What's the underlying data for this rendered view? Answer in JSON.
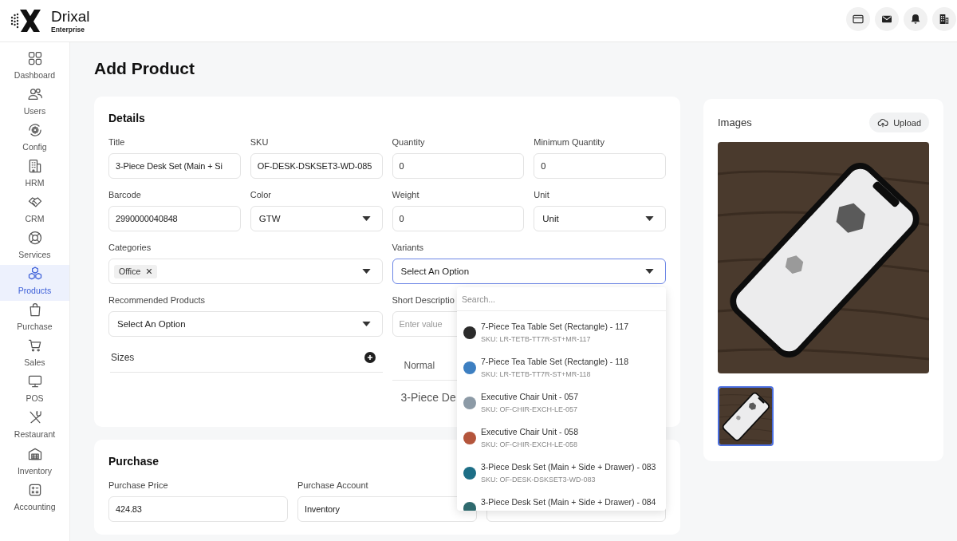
{
  "header": {
    "brand": "Drixal",
    "edition": "Enterprise"
  },
  "sidebar": {
    "items": [
      {
        "label": "Dashboard",
        "selected": false
      },
      {
        "label": "Users",
        "selected": false
      },
      {
        "label": "Config",
        "selected": false
      },
      {
        "label": "HRM",
        "selected": false
      },
      {
        "label": "CRM",
        "selected": false
      },
      {
        "label": "Services",
        "selected": false
      },
      {
        "label": "Products",
        "selected": true
      },
      {
        "label": "Purchase",
        "selected": false
      },
      {
        "label": "Sales",
        "selected": false
      },
      {
        "label": "POS",
        "selected": false
      },
      {
        "label": "Restaurant",
        "selected": false
      },
      {
        "label": "Inventory",
        "selected": false
      },
      {
        "label": "Accounting",
        "selected": false
      }
    ]
  },
  "page": {
    "title": "Add Product"
  },
  "details": {
    "title": "Details",
    "fields": [
      {
        "label": "Title",
        "kind": "input",
        "value": "3-Piece Desk Set (Main + Si"
      },
      {
        "label": "SKU",
        "kind": "input",
        "value": "OF-DESK-DSKSET3-WD-085"
      },
      {
        "label": "Quantity",
        "kind": "input",
        "value": "0"
      },
      {
        "label": "Minimum Quantity",
        "kind": "input",
        "value": "0"
      },
      {
        "label": "Barcode",
        "kind": "input",
        "value": "2990000040848"
      },
      {
        "label": "Color",
        "kind": "select",
        "value": "GTW"
      },
      {
        "label": "Weight",
        "kind": "input",
        "value": "0"
      },
      {
        "label": "Unit",
        "kind": "select",
        "value": "Unit"
      }
    ],
    "categories": {
      "label": "Categories",
      "tags": [
        {
          "label": "Office"
        }
      ]
    },
    "variants": {
      "label": "Variants",
      "placeholder": "Select An Option",
      "expanded": true,
      "dropdown": {
        "search_placeholder": "Search...",
        "options": [
          {
            "title": "7-Piece Tea Table Set (Rectangle) - 117",
            "sku": "SKU: LR-TETB-TT7R-ST+MR-117",
            "color": "#2b2b2b"
          },
          {
            "title": "7-Piece Tea Table Set (Rectangle) - 118",
            "sku": "SKU: LR-TETB-TT7R-ST+MR-118",
            "color": "#3d7fc1"
          },
          {
            "title": "Executive Chair Unit - 057",
            "sku": "SKU: OF-CHIR-EXCH-LE-057",
            "color": "#8c9aa6"
          },
          {
            "title": "Executive Chair Unit - 058",
            "sku": "SKU: OF-CHIR-EXCH-LE-058",
            "color": "#b4553c"
          },
          {
            "title": "3-Piece Desk Set (Main + Side + Drawer) - 083",
            "sku": "SKU: OF-DESK-DSKSET3-WD-083",
            "color": "#1d6e86"
          },
          {
            "title": "3-Piece Desk Set (Main + Side + Drawer) - 084",
            "color": "#2f6a6e"
          }
        ]
      }
    },
    "recommended_products": {
      "label": "Recommended Products",
      "placeholder": "Select An Option"
    },
    "sizes": {
      "label": "Sizes"
    },
    "short_description": {
      "label": "Short Descriptio",
      "placeholder": "Enter value",
      "editor": {
        "format": "Normal",
        "content": "3-Piece De"
      }
    }
  },
  "purchase": {
    "title": "Purchase",
    "fields": [
      {
        "label": "Purchase Price",
        "kind": "input",
        "value": "424.83"
      },
      {
        "label": "Purchase Account",
        "kind": "input",
        "value": "Inventory"
      },
      {
        "kind": "input"
      }
    ]
  },
  "images": {
    "title": "Images",
    "upload_label": "Upload",
    "thumbnails": [
      {
        "selected": true
      }
    ]
  }
}
